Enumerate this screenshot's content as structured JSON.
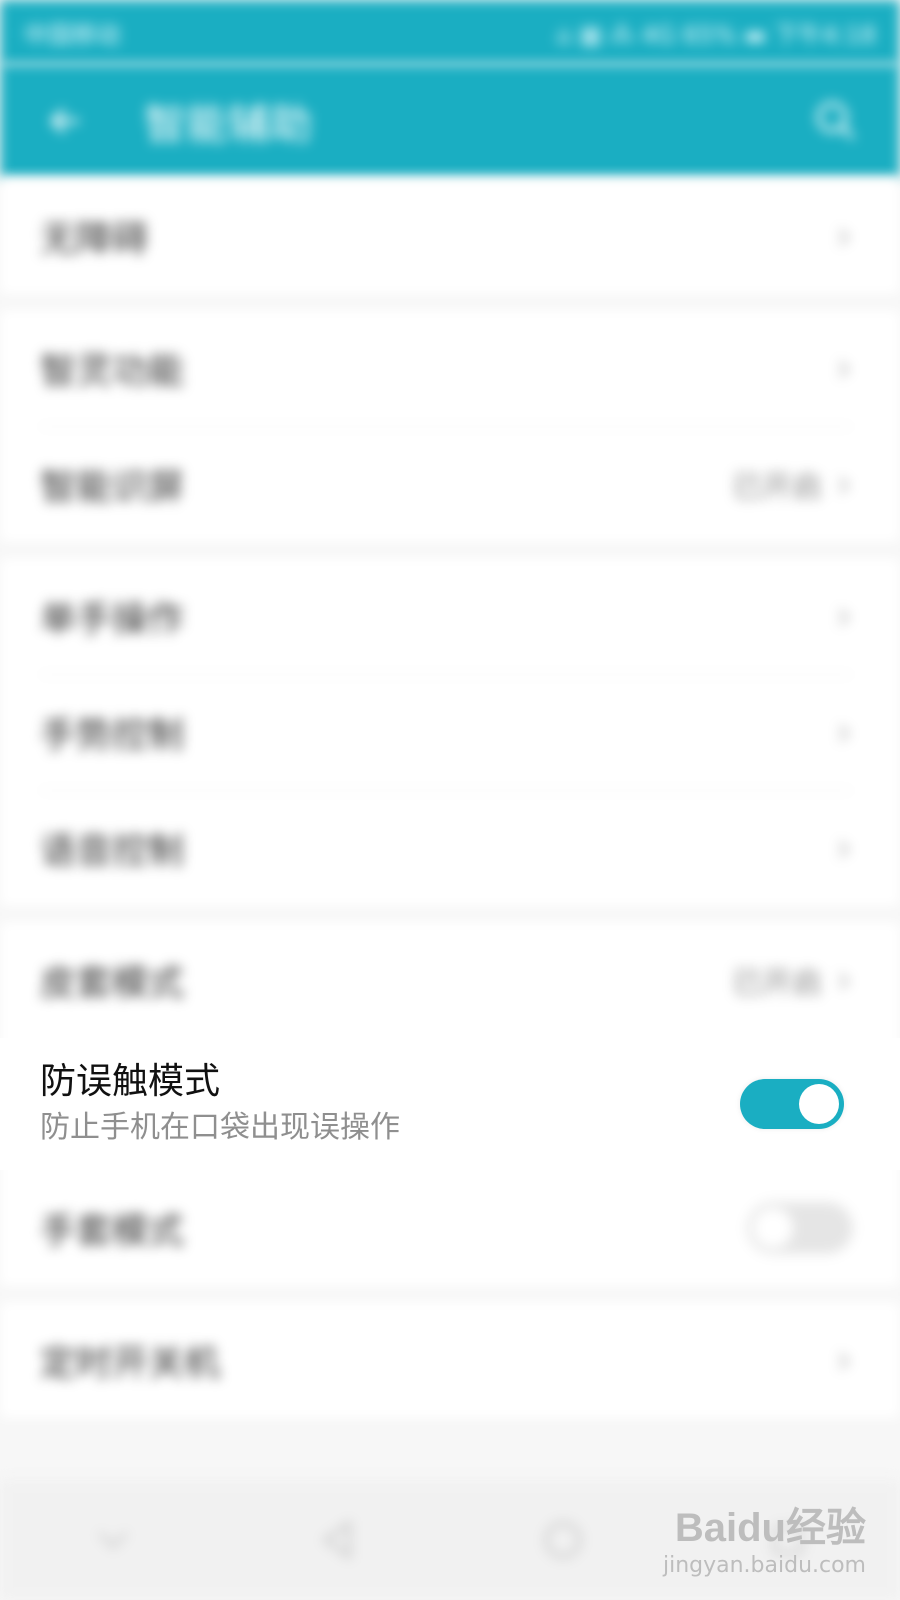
{
  "status_bar": {
    "carrier": "中国移动",
    "right": "⌂ ▦ ⁂ 4G 65% ▬ 下午4:18"
  },
  "app_bar": {
    "title": "智能辅助"
  },
  "groups": [
    {
      "items": [
        {
          "label": "无障碍",
          "value": ""
        }
      ]
    },
    {
      "items": [
        {
          "label": "智灵功能",
          "value": ""
        },
        {
          "label": "智能识屏",
          "value": "已开启"
        }
      ]
    },
    {
      "items": [
        {
          "label": "单手操作",
          "value": ""
        },
        {
          "label": "手势控制",
          "value": ""
        },
        {
          "label": "语音控制",
          "value": ""
        }
      ]
    },
    {
      "items": [
        {
          "label": "皮套模式",
          "value": "已开启"
        }
      ]
    }
  ],
  "focus_item": {
    "title": "防误触模式",
    "subtitle": "防止手机在口袋出现误操作",
    "enabled": true
  },
  "below_items": [
    {
      "label": "手套模式",
      "toggle": false
    }
  ],
  "last_group": [
    {
      "label": "定时开关机",
      "value": ""
    }
  ],
  "watermark": {
    "brand": "Baidu经验",
    "site": "jingyan.baidu.com"
  },
  "colors": {
    "accent": "#1aaec2",
    "toggle_on": "#1aaec2"
  },
  "icons": {
    "back": "arrow-left",
    "search": "search",
    "chevron": "chevron-right",
    "nav_down": "chevron-down",
    "nav_back": "triangle-left",
    "nav_home": "circle",
    "nav_recent": "square"
  }
}
